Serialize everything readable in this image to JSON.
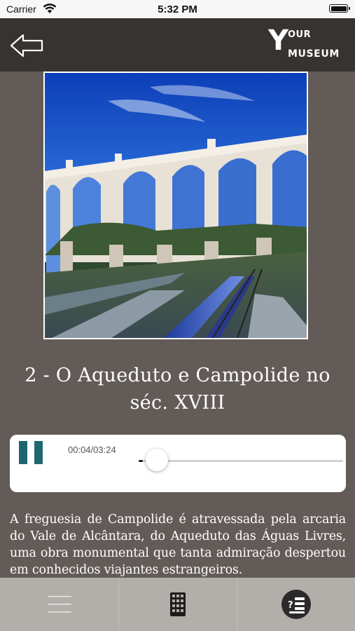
{
  "status_bar": {
    "carrier": "Carrier",
    "time": "5:32 PM"
  },
  "header": {
    "back_icon": "back-arrow-icon",
    "logo": {
      "big_letter": "Y",
      "our": "OUR",
      "museum": "MUSEUM"
    }
  },
  "artwork": {
    "image": "aqueduct-photo",
    "title": "2 - O Aqueduto e Campolide no séc. XVIII"
  },
  "player": {
    "state_icon": "pause-icon",
    "elapsed": "00:04",
    "duration": "03:24",
    "time_label": "00:04/03:24",
    "progress_fraction": 0.02
  },
  "description": "A freguesia de Campolide é atravessada pela arcaria do Vale de Alcântara, do Aqueduto das Águas Livres, uma obra monumental que tanta admiração despertou em conhecidos viajantes estrangeiros.",
  "tabbar": {
    "items": [
      {
        "icon": "menu-icon"
      },
      {
        "icon": "keypad-icon"
      },
      {
        "icon": "quiz-list-icon"
      }
    ]
  },
  "colors": {
    "background": "#625b57",
    "header": "#363331",
    "accent": "#1e6770",
    "tabbar": "#b2aeaa"
  }
}
